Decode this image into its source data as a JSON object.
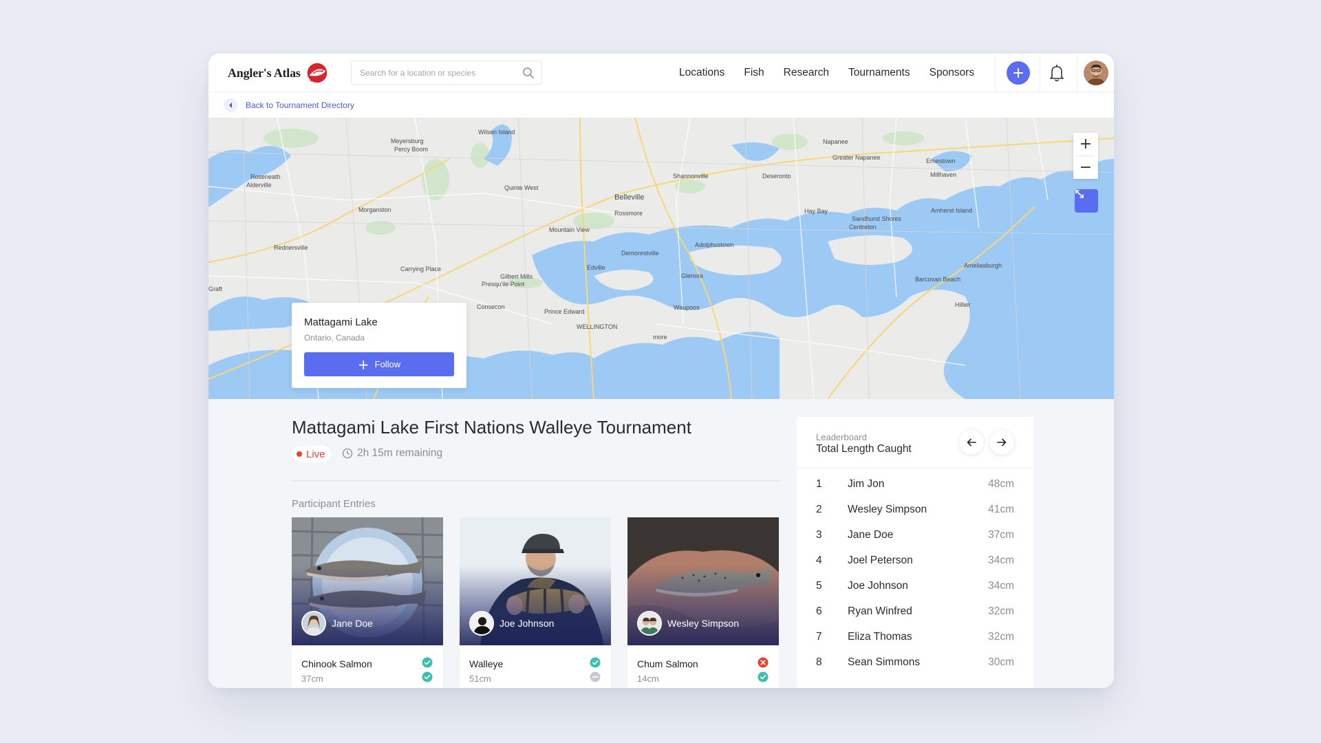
{
  "header": {
    "logo_text": "Angler's Atlas",
    "search": {
      "placeholder": "Search for a location or species",
      "value": ""
    },
    "nav": [
      "Locations",
      "Fish",
      "Research",
      "Tournaments",
      "Sponsors"
    ],
    "icons": [
      "search-icon",
      "plus-icon",
      "bell-icon",
      "user-avatar"
    ],
    "accent_color": "#5a6df0"
  },
  "back_link": {
    "label": "Back to Tournament Directory"
  },
  "map": {
    "labels": [
      "Wilson Island",
      "Meyersburg",
      "Percy Boom",
      "Roseneath",
      "Alderville",
      "Quinte West",
      "Morganston",
      "Belleville",
      "Rossmore",
      "Shannonville",
      "Deseronto",
      "Napanee",
      "Greater Napanee",
      "Ernestown",
      "Millhaven",
      "Amherst Island",
      "Hay Bay",
      "Sandhurst Shores",
      "Centreton",
      "Rednersville",
      "Mountain View",
      "Demorestville",
      "Adolphustown",
      "Ameliasburgh",
      "Edville",
      "Carrying Place",
      "Gilbert Mills",
      "Glenora",
      "Barcovan Beach",
      "Presqu'ile Point",
      "Consecon",
      "Prince Edward",
      "Waupoos",
      "Hillier",
      "WELLINGTON",
      "more",
      "Graft"
    ],
    "controls": {
      "zoom_in": "+",
      "zoom_out": "−"
    },
    "lake_card": {
      "name": "Mattagami Lake",
      "location": "Ontario, Canada",
      "follow_label": "Follow"
    }
  },
  "tournament": {
    "title": "Mattagami Lake First Nations Walleye Tournament",
    "status": "Live",
    "remaining": "2h 15m remaining",
    "status_color": "#e5432f"
  },
  "entries": {
    "label": "Participant Entries",
    "items": [
      {
        "user": "Jane Doe",
        "species": "Chinook Salmon",
        "size": "37cm",
        "checks": [
          "approved",
          "approved"
        ]
      },
      {
        "user": "Joe Johnson",
        "species": "Walleye",
        "size": "51cm",
        "checks": [
          "approved",
          "pending"
        ]
      },
      {
        "user": "Wesley Simpson",
        "species": "Chum Salmon",
        "size": "14cm",
        "checks": [
          "rejected",
          "approved"
        ]
      }
    ]
  },
  "leaderboard": {
    "kicker": "Leaderboard",
    "title": "Total Length Caught",
    "rows": [
      {
        "rank": "1",
        "name": "Jim Jon",
        "length": "48cm"
      },
      {
        "rank": "2",
        "name": "Wesley Simpson",
        "length": "41cm"
      },
      {
        "rank": "3",
        "name": "Jane Doe",
        "length": "37cm"
      },
      {
        "rank": "4",
        "name": "Joel Peterson",
        "length": "34cm"
      },
      {
        "rank": "5",
        "name": "Joe Johnson",
        "length": "34cm"
      },
      {
        "rank": "6",
        "name": "Ryan Winfred",
        "length": "32cm"
      },
      {
        "rank": "7",
        "name": "Eliza Thomas",
        "length": "32cm"
      },
      {
        "rank": "8",
        "name": "Sean Simmons",
        "length": "30cm"
      }
    ]
  }
}
